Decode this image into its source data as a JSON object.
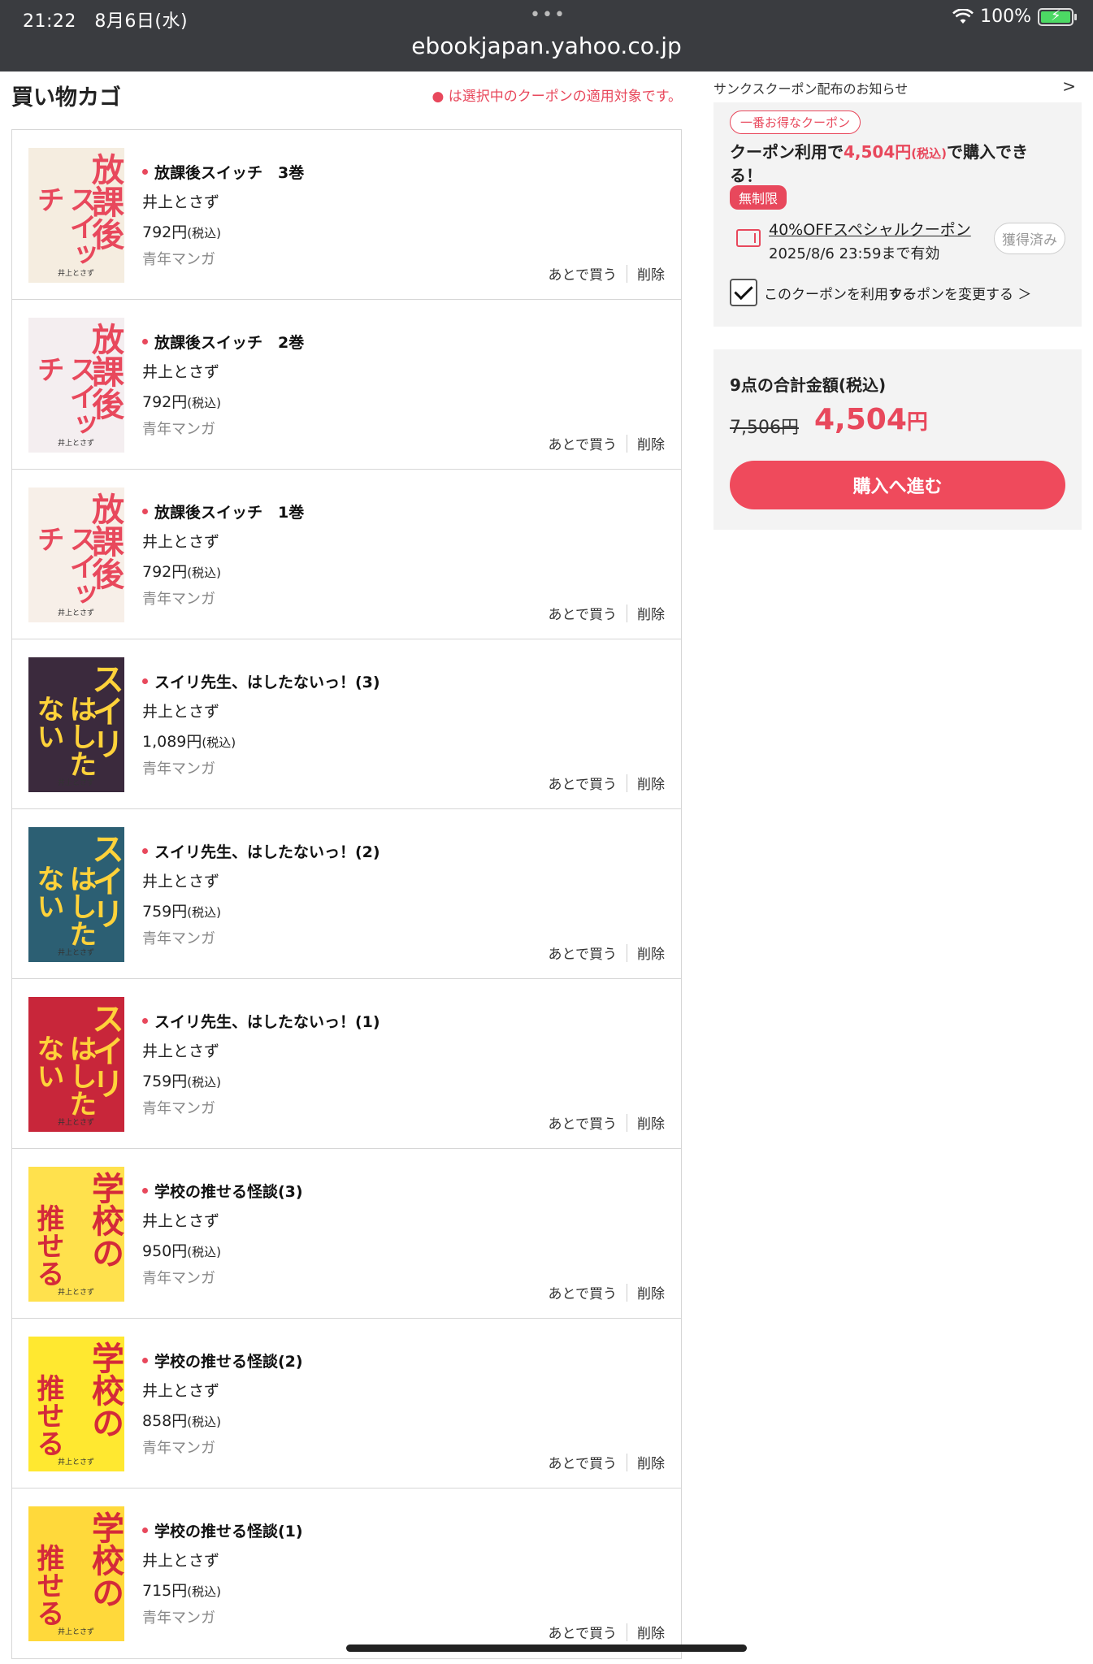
{
  "status_bar": {
    "time": "21:22",
    "date": "8月6日(水)",
    "dots": "•••",
    "battery": "100%",
    "battery_level": 1.0,
    "url": "ebookjapan.yahoo.co.jp"
  },
  "cart": {
    "title": "買い物カゴ",
    "coupon_note": "● は選択中のクーポンの適用対象です。",
    "action_later": "あとで買う",
    "action_delete": "削除",
    "tax_suffix": "(税込)",
    "items": [
      {
        "title": "放課後スイッチ　3巻",
        "author": "井上とさず",
        "price": "792円",
        "genre": "青年マンガ",
        "cover_t1": "放課後",
        "cover_t2": "スイッチ",
        "cover_bg": "#f5ede0",
        "cover_fg": "#e8485c"
      },
      {
        "title": "放課後スイッチ　2巻",
        "author": "井上とさず",
        "price": "792円",
        "genre": "青年マンガ",
        "cover_t1": "放課後",
        "cover_t2": "スイッチ",
        "cover_bg": "#f4eef0",
        "cover_fg": "#e8485c"
      },
      {
        "title": "放課後スイッチ　1巻",
        "author": "井上とさず",
        "price": "792円",
        "genre": "青年マンガ",
        "cover_t1": "放課後",
        "cover_t2": "スイッチ",
        "cover_bg": "#f7efe8",
        "cover_fg": "#e8485c"
      },
      {
        "title": "スイリ先生、はしたないっ！(3)",
        "author": "井上とさず",
        "price": "1,089円",
        "genre": "青年マンガ",
        "cover_t1": "スイリ",
        "cover_t2": "はしたない",
        "cover_bg": "#3b2a3d",
        "cover_fg": "#ffd23a"
      },
      {
        "title": "スイリ先生、はしたないっ！(2)",
        "author": "井上とさず",
        "price": "759円",
        "genre": "青年マンガ",
        "cover_t1": "スイリ",
        "cover_t2": "はしたない",
        "cover_bg": "#2c5f73",
        "cover_fg": "#ffd23a"
      },
      {
        "title": "スイリ先生、はしたないっ！(1)",
        "author": "井上とさず",
        "price": "759円",
        "genre": "青年マンガ",
        "cover_t1": "スイリ",
        "cover_t2": "はしたない",
        "cover_bg": "#c8263a",
        "cover_fg": "#ffd23a"
      },
      {
        "title": "学校の推せる怪談(3)",
        "author": "井上とさず",
        "price": "950円",
        "genre": "青年マンガ",
        "cover_t1": "学校の",
        "cover_t2": "推せる",
        "cover_bg": "#ffe14d",
        "cover_fg": "#d42a3a"
      },
      {
        "title": "学校の推せる怪談(2)",
        "author": "井上とさず",
        "price": "858円",
        "genre": "青年マンガ",
        "cover_t1": "学校の",
        "cover_t2": "推せる",
        "cover_bg": "#ffe830",
        "cover_fg": "#d42a3a"
      },
      {
        "title": "学校の推せる怪談(1)",
        "author": "井上とさず",
        "price": "715円",
        "genre": "青年マンガ",
        "cover_t1": "学校の",
        "cover_t2": "推せる",
        "cover_bg": "#ffd93b",
        "cover_fg": "#d42a3a"
      }
    ]
  },
  "sidebar": {
    "notice": "サンクスクーポン配布のお知らせ",
    "notice_chevron": ">",
    "coupon": {
      "badge": "一番お得なクーポン",
      "headline_pre": "クーポン利用で",
      "headline_price": "4,504円",
      "headline_tax": "(税込)",
      "headline_post": "で購入できる！",
      "unlimited": "無制限",
      "name": "40%OFFスペシャルクーポン",
      "expiry": "2025/8/6 23:59まで有効",
      "acquired": "獲得済み",
      "use_label": "このクーポンを利用する",
      "change_link": "クーポンを変更する ＞"
    },
    "total": {
      "label": "9点の合計金額(税込)",
      "original": "7,506円",
      "final_amount": "4,504",
      "final_unit": "円",
      "buy_button": "購入へ進む"
    }
  },
  "colors": {
    "accent": "#e8485c",
    "statusbar_bg": "#3a3c40",
    "panel_bg": "#f3f3f3"
  }
}
